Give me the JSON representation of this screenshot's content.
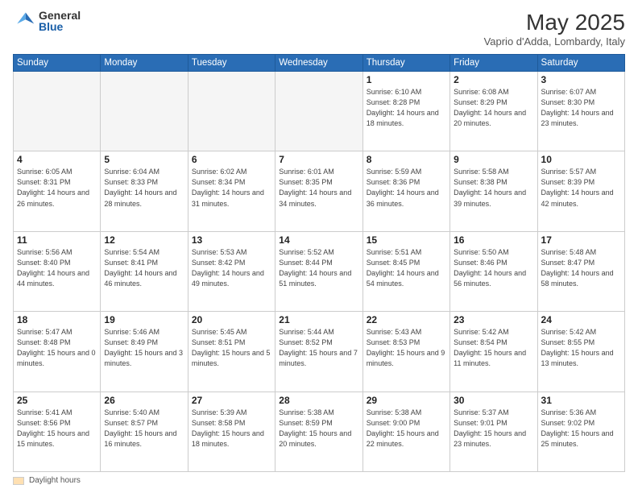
{
  "header": {
    "logo_general": "General",
    "logo_blue": "Blue",
    "title": "May 2025",
    "location": "Vaprio d'Adda, Lombardy, Italy"
  },
  "days_of_week": [
    "Sunday",
    "Monday",
    "Tuesday",
    "Wednesday",
    "Thursday",
    "Friday",
    "Saturday"
  ],
  "weeks": [
    [
      {
        "day": "",
        "empty": true
      },
      {
        "day": "",
        "empty": true
      },
      {
        "day": "",
        "empty": true
      },
      {
        "day": "",
        "empty": true
      },
      {
        "day": "1",
        "sunrise": "6:10 AM",
        "sunset": "8:28 PM",
        "daylight": "14 hours and 18 minutes."
      },
      {
        "day": "2",
        "sunrise": "6:08 AM",
        "sunset": "8:29 PM",
        "daylight": "14 hours and 20 minutes."
      },
      {
        "day": "3",
        "sunrise": "6:07 AM",
        "sunset": "8:30 PM",
        "daylight": "14 hours and 23 minutes."
      }
    ],
    [
      {
        "day": "4",
        "sunrise": "6:05 AM",
        "sunset": "8:31 PM",
        "daylight": "14 hours and 26 minutes."
      },
      {
        "day": "5",
        "sunrise": "6:04 AM",
        "sunset": "8:33 PM",
        "daylight": "14 hours and 28 minutes."
      },
      {
        "day": "6",
        "sunrise": "6:02 AM",
        "sunset": "8:34 PM",
        "daylight": "14 hours and 31 minutes."
      },
      {
        "day": "7",
        "sunrise": "6:01 AM",
        "sunset": "8:35 PM",
        "daylight": "14 hours and 34 minutes."
      },
      {
        "day": "8",
        "sunrise": "5:59 AM",
        "sunset": "8:36 PM",
        "daylight": "14 hours and 36 minutes."
      },
      {
        "day": "9",
        "sunrise": "5:58 AM",
        "sunset": "8:38 PM",
        "daylight": "14 hours and 39 minutes."
      },
      {
        "day": "10",
        "sunrise": "5:57 AM",
        "sunset": "8:39 PM",
        "daylight": "14 hours and 42 minutes."
      }
    ],
    [
      {
        "day": "11",
        "sunrise": "5:56 AM",
        "sunset": "8:40 PM",
        "daylight": "14 hours and 44 minutes."
      },
      {
        "day": "12",
        "sunrise": "5:54 AM",
        "sunset": "8:41 PM",
        "daylight": "14 hours and 46 minutes."
      },
      {
        "day": "13",
        "sunrise": "5:53 AM",
        "sunset": "8:42 PM",
        "daylight": "14 hours and 49 minutes."
      },
      {
        "day": "14",
        "sunrise": "5:52 AM",
        "sunset": "8:44 PM",
        "daylight": "14 hours and 51 minutes."
      },
      {
        "day": "15",
        "sunrise": "5:51 AM",
        "sunset": "8:45 PM",
        "daylight": "14 hours and 54 minutes."
      },
      {
        "day": "16",
        "sunrise": "5:50 AM",
        "sunset": "8:46 PM",
        "daylight": "14 hours and 56 minutes."
      },
      {
        "day": "17",
        "sunrise": "5:48 AM",
        "sunset": "8:47 PM",
        "daylight": "14 hours and 58 minutes."
      }
    ],
    [
      {
        "day": "18",
        "sunrise": "5:47 AM",
        "sunset": "8:48 PM",
        "daylight": "15 hours and 0 minutes."
      },
      {
        "day": "19",
        "sunrise": "5:46 AM",
        "sunset": "8:49 PM",
        "daylight": "15 hours and 3 minutes."
      },
      {
        "day": "20",
        "sunrise": "5:45 AM",
        "sunset": "8:51 PM",
        "daylight": "15 hours and 5 minutes."
      },
      {
        "day": "21",
        "sunrise": "5:44 AM",
        "sunset": "8:52 PM",
        "daylight": "15 hours and 7 minutes."
      },
      {
        "day": "22",
        "sunrise": "5:43 AM",
        "sunset": "8:53 PM",
        "daylight": "15 hours and 9 minutes."
      },
      {
        "day": "23",
        "sunrise": "5:42 AM",
        "sunset": "8:54 PM",
        "daylight": "15 hours and 11 minutes."
      },
      {
        "day": "24",
        "sunrise": "5:42 AM",
        "sunset": "8:55 PM",
        "daylight": "15 hours and 13 minutes."
      }
    ],
    [
      {
        "day": "25",
        "sunrise": "5:41 AM",
        "sunset": "8:56 PM",
        "daylight": "15 hours and 15 minutes."
      },
      {
        "day": "26",
        "sunrise": "5:40 AM",
        "sunset": "8:57 PM",
        "daylight": "15 hours and 16 minutes."
      },
      {
        "day": "27",
        "sunrise": "5:39 AM",
        "sunset": "8:58 PM",
        "daylight": "15 hours and 18 minutes."
      },
      {
        "day": "28",
        "sunrise": "5:38 AM",
        "sunset": "8:59 PM",
        "daylight": "15 hours and 20 minutes."
      },
      {
        "day": "29",
        "sunrise": "5:38 AM",
        "sunset": "9:00 PM",
        "daylight": "15 hours and 22 minutes."
      },
      {
        "day": "30",
        "sunrise": "5:37 AM",
        "sunset": "9:01 PM",
        "daylight": "15 hours and 23 minutes."
      },
      {
        "day": "31",
        "sunrise": "5:36 AM",
        "sunset": "9:02 PM",
        "daylight": "15 hours and 25 minutes."
      }
    ]
  ],
  "footer": {
    "legend_label": "Daylight hours"
  }
}
